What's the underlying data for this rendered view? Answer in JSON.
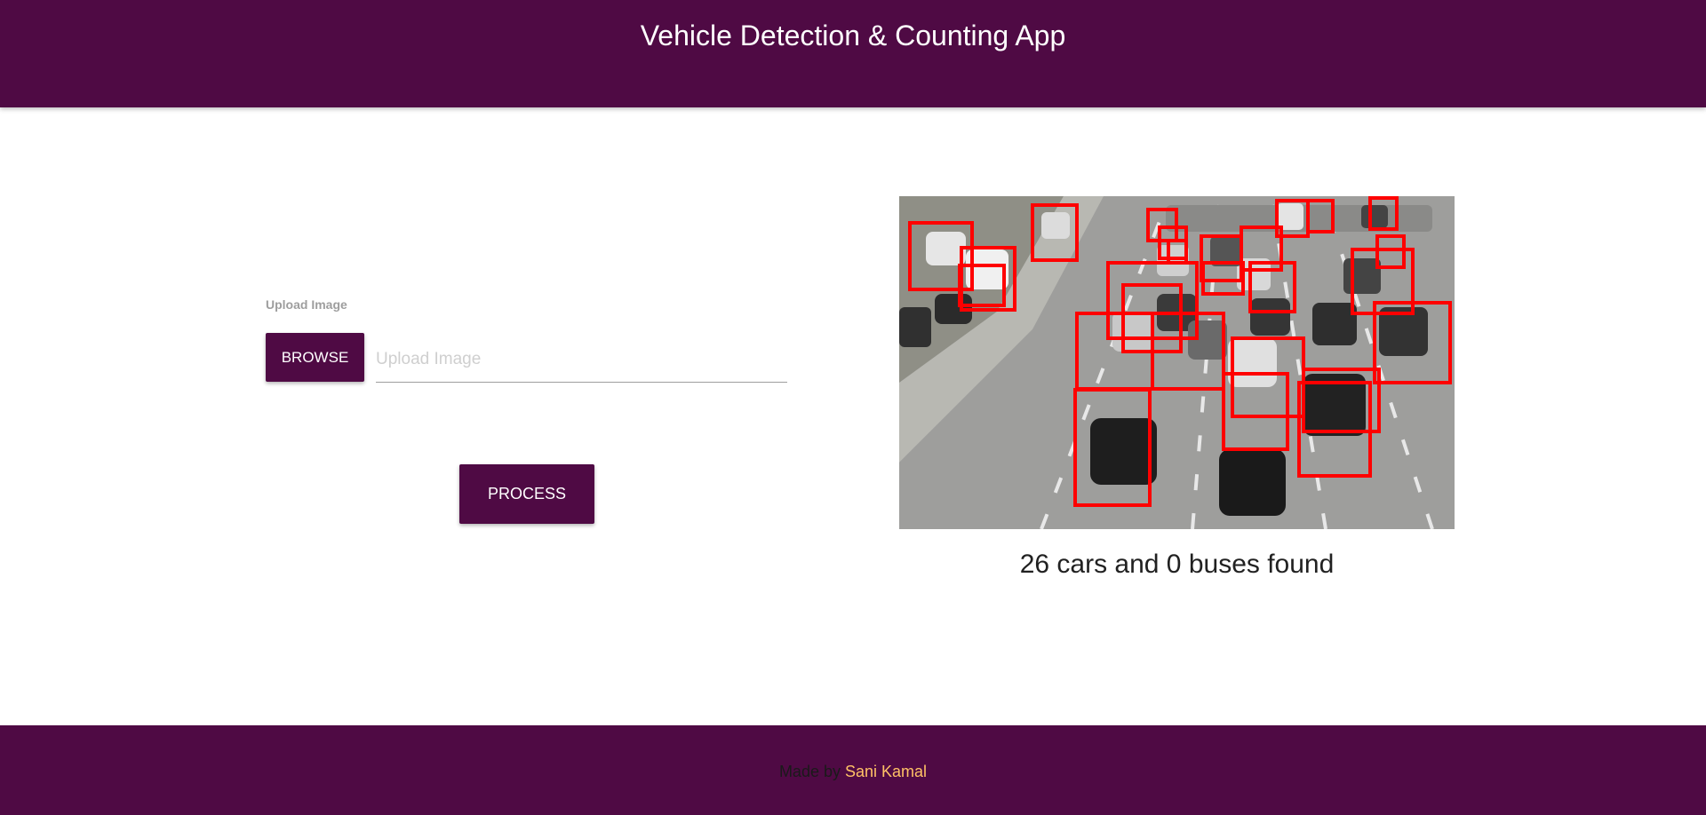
{
  "header": {
    "title": "Vehicle Detection & Counting App"
  },
  "form": {
    "label": "Upload Image",
    "browse_label": "BROWSE",
    "input_placeholder": "Upload Image",
    "input_value": "",
    "process_label": "PROCESS"
  },
  "result": {
    "text": "26 cars and 0 buses found",
    "box_color": "#ff0000",
    "detections_count": 26
  },
  "footer": {
    "prefix": "Made by",
    "author": "Sani Kamal",
    "author_color": "#ffc266"
  },
  "colors": {
    "brand": "#4f0a44",
    "background": "#ffffff"
  }
}
